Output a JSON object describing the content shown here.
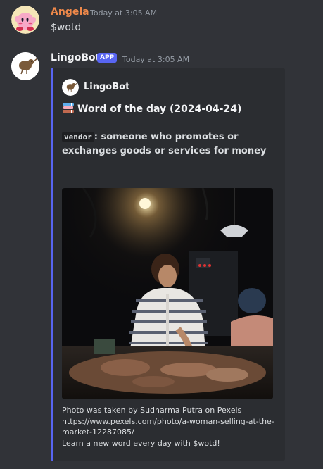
{
  "messages": [
    {
      "author": "Angela",
      "author_color": "#f0894a",
      "timestamp": "Today at 3:05 AM",
      "text": "$wotd",
      "avatar_icon": "kirby-avatar-icon"
    },
    {
      "author": "LingoBot",
      "author_color": "#f2f3f5",
      "badge": "APP",
      "timestamp": "Today at 3:05 AM",
      "avatar_icon": "kiwi-bird-avatar-icon",
      "embed": {
        "accent_color": "#5865f2",
        "author_name": "LingoBot",
        "title_icon": "books-icon",
        "title": "Word of the day (2024-04-24)",
        "word": "vendor",
        "definition": ": someone who promotes or exchanges goods or services for money",
        "image_subject": "woman-selling-at-market-photo",
        "footer_line1": "Photo was taken by Sudharma Putra on Pexels",
        "footer_line2": "https://www.pexels.com/photo/a-woman-selling-at-the-market-12287085/",
        "footer_line3": "Learn a new word every day with $wotd!"
      }
    }
  ],
  "colors": {
    "background": "#313338",
    "embed_background": "#2b2d31",
    "blurple": "#5865f2",
    "muted": "#949ba4"
  }
}
